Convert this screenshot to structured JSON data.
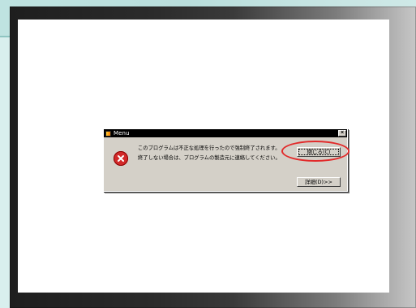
{
  "dialog": {
    "title": "Menu",
    "close_glyph": "×",
    "message_line1": "このプログラムは不正な処理を行ったので強制終了されます。",
    "message_line2": "終了しない場合は、プログラムの製造元に連絡してください。",
    "buttons": {
      "close_label": "閉じる(C)",
      "details_label": "詳細(D)>>"
    }
  },
  "icons": {
    "app": "app-icon",
    "error": "error-icon",
    "titlebar_close": "close-icon"
  },
  "colors": {
    "dialog_bg": "#d4d0c8",
    "titlebar_bg": "#000000",
    "error_red": "#d22a2a",
    "annotation_red": "#e22a2a",
    "page_bg": "#d9efee"
  }
}
